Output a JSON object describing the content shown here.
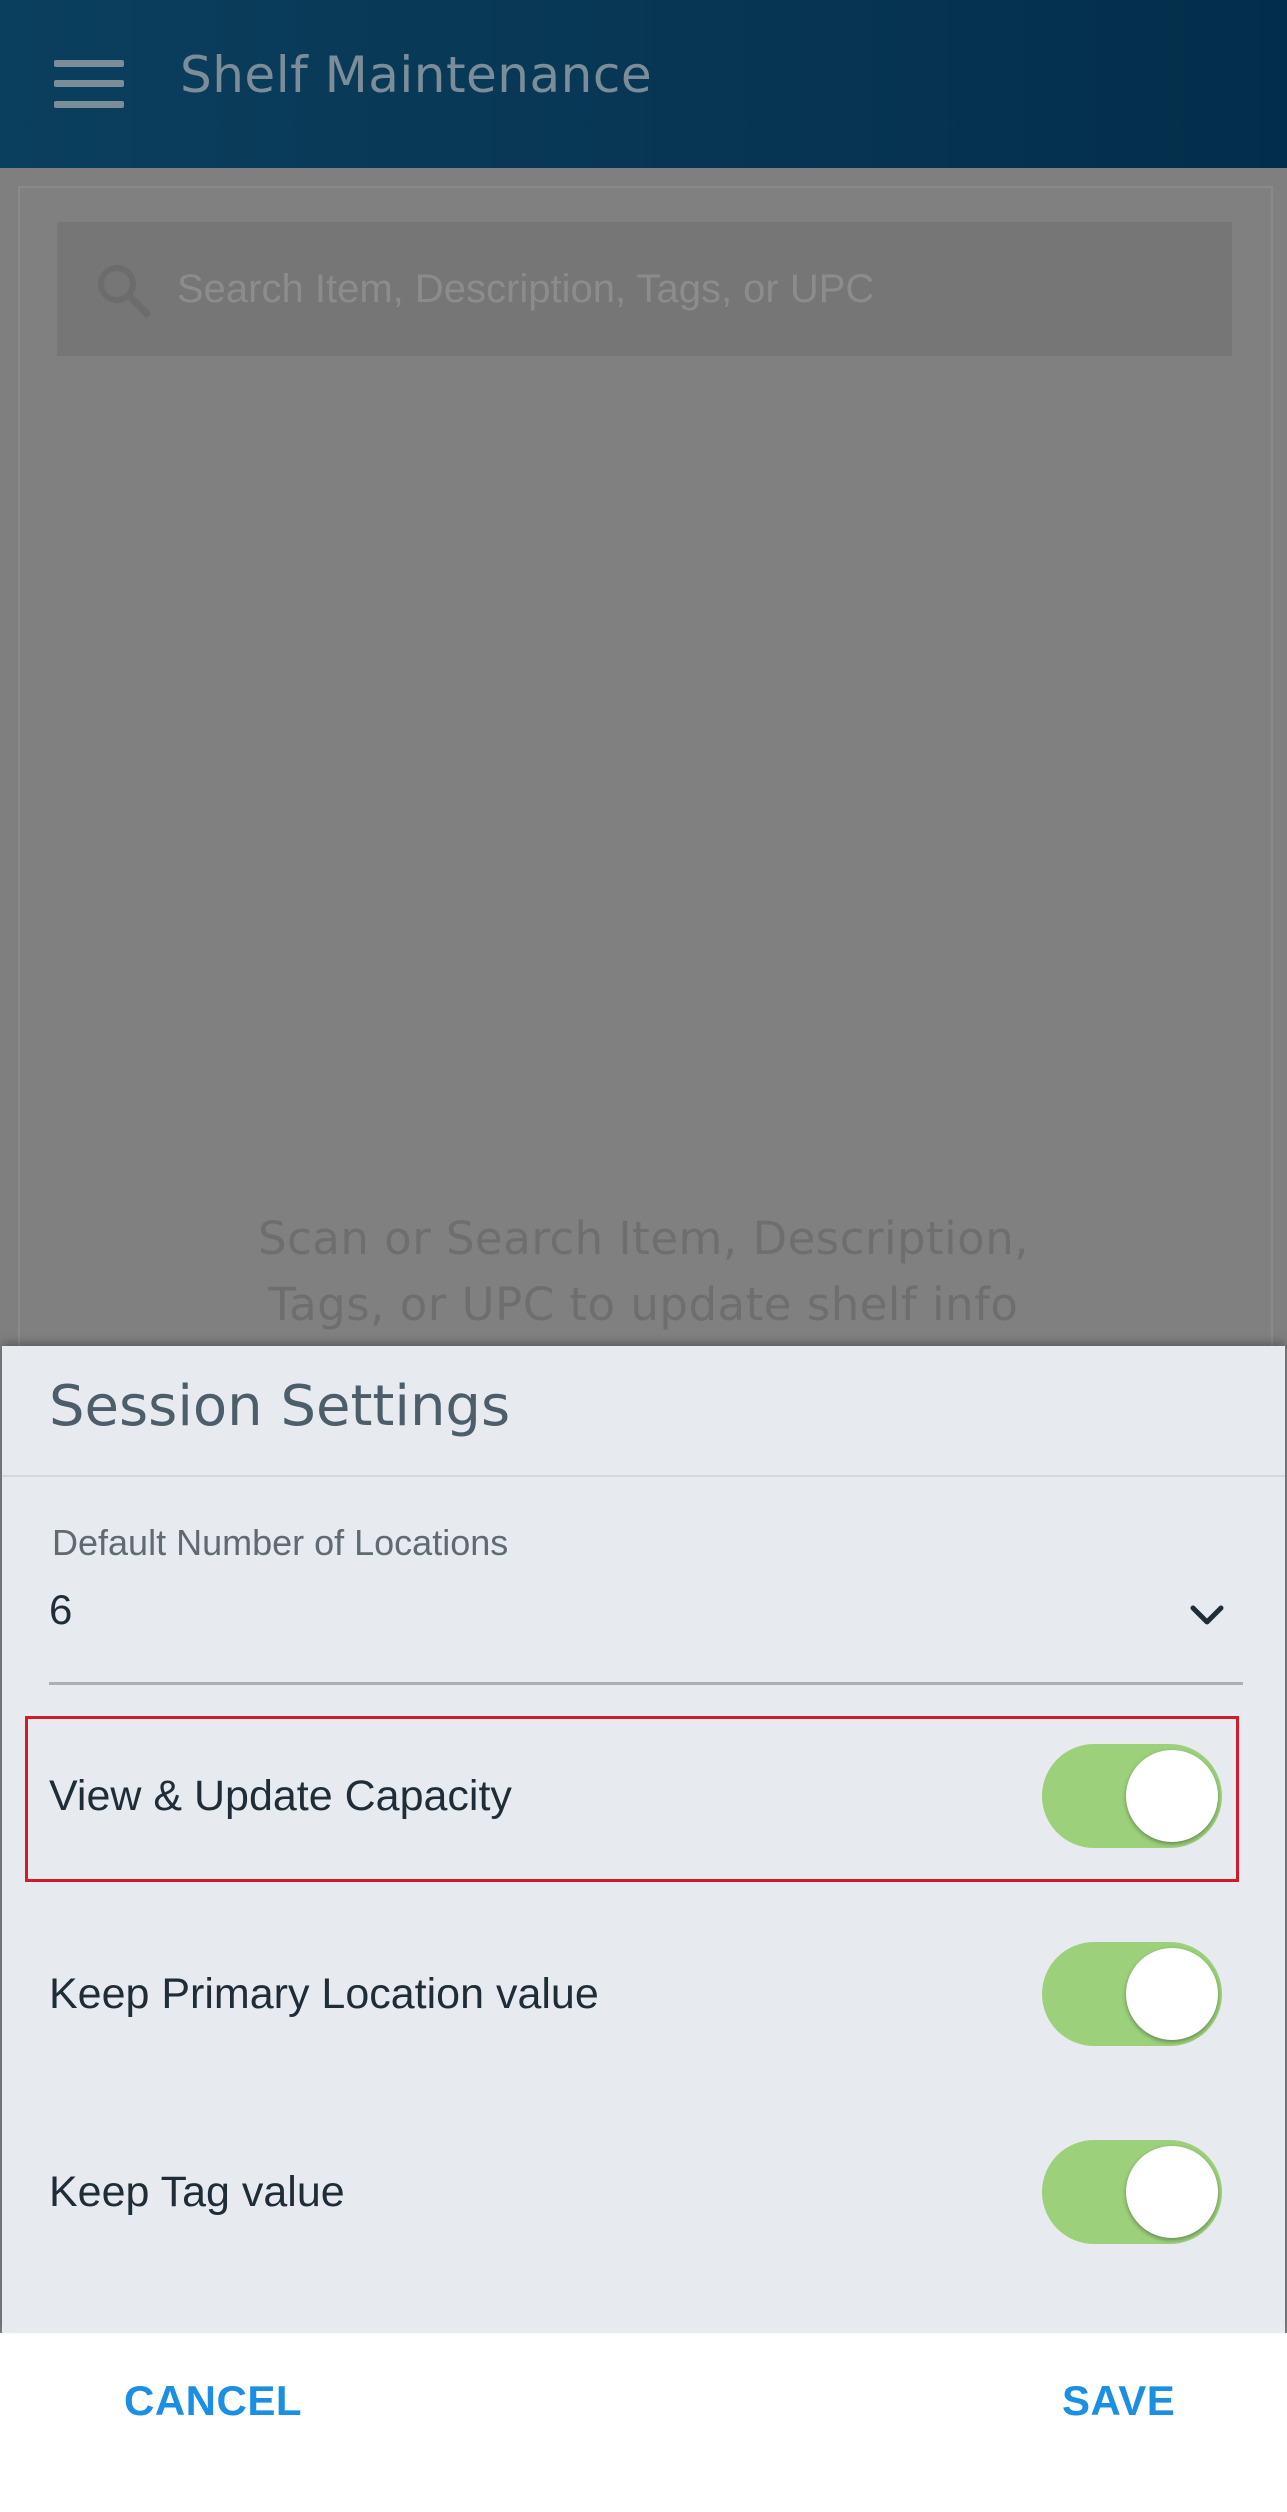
{
  "header": {
    "title": "Shelf Maintenance",
    "menu_icon": "hamburger-menu-icon"
  },
  "search": {
    "placeholder": "Search Item, Description, Tags, or UPC",
    "icon": "search-icon"
  },
  "empty_state": {
    "line1": "Scan or Search Item, Description,",
    "line2": "Tags, or UPC to update shelf info"
  },
  "session_settings": {
    "title": "Session Settings",
    "default_locations": {
      "label": "Default Number of Locations",
      "value": "6"
    },
    "toggles": [
      {
        "label": "View & Update Capacity",
        "on": true,
        "highlighted": true
      },
      {
        "label": "Keep Primary Location value",
        "on": true
      },
      {
        "label": "Keep Tag value",
        "on": true
      }
    ]
  },
  "footer": {
    "cancel_label": "CANCEL",
    "save_label": "SAVE"
  },
  "colors": {
    "header_bg": "#063552",
    "toggle_on": "#9cd07b",
    "action_blue": "#1b8fe2",
    "highlight_red": "#d11a2a",
    "overlay_gray": "#7f7f7f",
    "sheet_bg": "#e7ebef"
  }
}
